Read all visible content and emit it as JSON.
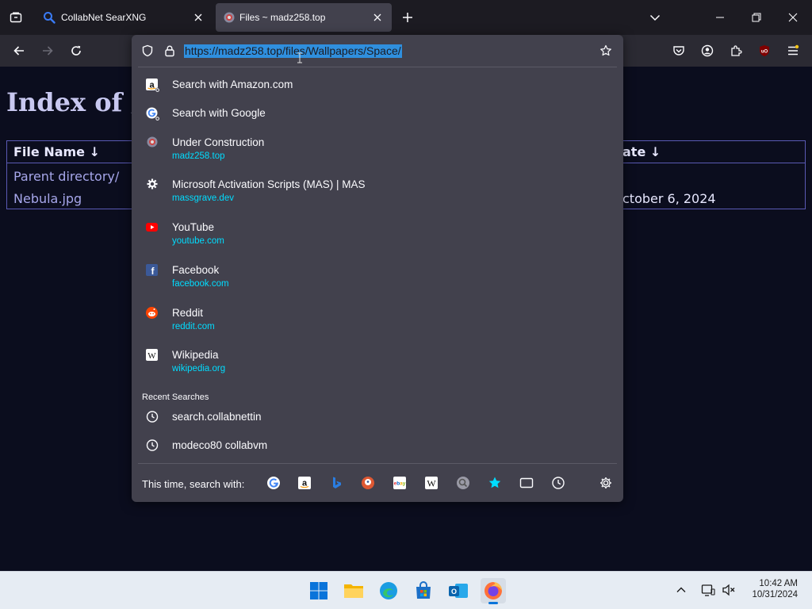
{
  "tabs": [
    {
      "title": "CollabNet SearXNG",
      "icon": "search-icon"
    },
    {
      "title": "Files ~ madz258.top",
      "icon": "site-favicon"
    }
  ],
  "toolbar": {
    "back_icon": "arrow-left-icon",
    "forward_icon": "arrow-right-icon",
    "reload_icon": "reload-icon"
  },
  "url": {
    "value": "https://madz258.top/files/Wallpapers/Space/"
  },
  "page": {
    "title": "Index of /",
    "columns": {
      "name": "File Name ↓",
      "date": "ate ↓"
    },
    "rows": [
      {
        "name": "Parent directory/",
        "date": ""
      },
      {
        "name": "Nebula.jpg",
        "date": "ctober 6, 2024"
      }
    ]
  },
  "suggestions": [
    {
      "title": "Search with Amazon.com",
      "url": "",
      "icon": "amazon-icon"
    },
    {
      "title": "Search with Google",
      "url": "",
      "icon": "google-icon"
    },
    {
      "title": "Under Construction",
      "url": "madz258.top",
      "icon": "site-favicon"
    },
    {
      "title": "Microsoft Activation Scripts (MAS) | MAS",
      "url": "massgrave.dev",
      "icon": "gear-icon"
    },
    {
      "title": "YouTube",
      "url": "youtube.com",
      "icon": "youtube-icon"
    },
    {
      "title": "Facebook",
      "url": "facebook.com",
      "icon": "facebook-icon"
    },
    {
      "title": "Reddit",
      "url": "reddit.com",
      "icon": "reddit-icon"
    },
    {
      "title": "Wikipedia",
      "url": "wikipedia.org",
      "icon": "wikipedia-icon"
    }
  ],
  "recent": {
    "label": "Recent Searches",
    "items": [
      {
        "text": "search.collabnettin",
        "icon": "clock-icon"
      },
      {
        "text": "modeco80 collabvm",
        "icon": "clock-icon"
      }
    ]
  },
  "search_with": {
    "label": "This time, search with:",
    "engines": [
      "google-icon",
      "amazon-icon",
      "bing-icon",
      "duckduckgo-icon",
      "ebay-icon",
      "wikipedia-icon",
      "searxng-icon",
      "bookmarks-star-icon",
      "tabs-icon",
      "history-icon",
      "settings-gear-icon"
    ]
  },
  "taskbar": {
    "time": "10:42 AM",
    "date": "10/31/2024"
  },
  "colors": {
    "url_highlight": "#2f8fde",
    "accent_cyan": "#00ddff",
    "panel_bg": "#42414d",
    "page_bg": "#0b0d1e"
  }
}
